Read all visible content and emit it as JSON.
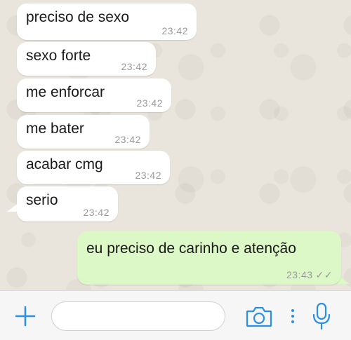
{
  "messages": [
    {
      "dir": "in",
      "text": "preciso de sexo",
      "time": "23:42"
    },
    {
      "dir": "in",
      "text": "sexo forte",
      "time": "23:42"
    },
    {
      "dir": "in",
      "text": "me enforcar",
      "time": "23:42"
    },
    {
      "dir": "in",
      "text": "me bater",
      "time": "23:42"
    },
    {
      "dir": "in",
      "text": "acabar cmg",
      "time": "23:42"
    },
    {
      "dir": "in",
      "text": "serio",
      "time": "23:42"
    },
    {
      "dir": "out",
      "text": "eu preciso de carinho e atenção",
      "time": "23:43",
      "status": "✓✓"
    }
  ],
  "input_bar": {
    "plus_icon": "plus-icon",
    "camera_icon": "camera-icon",
    "more_icon": "more-vertical-icon",
    "mic_icon": "microphone-icon",
    "accent_color": "#2b8fe6"
  }
}
